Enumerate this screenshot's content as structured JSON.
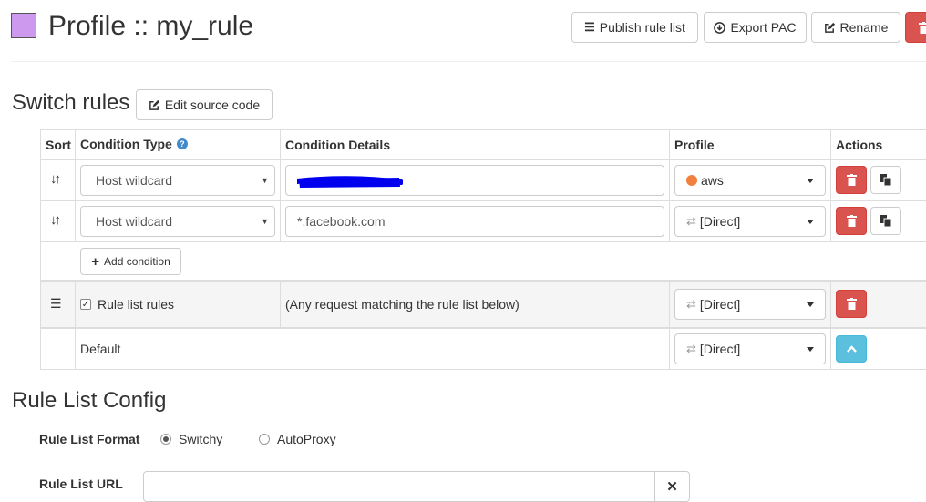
{
  "header": {
    "title": "Profile :: my_rule",
    "profile_color": "#cc99ee",
    "publish_label": "Publish rule list",
    "export_label": "Export PAC",
    "rename_label": "Rename"
  },
  "switch_rules": {
    "heading": "Switch rules",
    "edit_source_label": "Edit source code",
    "columns": {
      "sort": "Sort",
      "condition_type": "Condition Type",
      "condition_details": "Condition Details",
      "profile": "Profile",
      "actions": "Actions"
    },
    "rows": [
      {
        "condition_type": "Host wildcard",
        "condition_details": "",
        "profile": "aws",
        "profile_icon": "globe-icon",
        "profile_icon_color": "#f0803c"
      },
      {
        "condition_type": "Host wildcard",
        "condition_details": "*.facebook.com",
        "profile": "[Direct]",
        "profile_icon": "transfer-icon"
      }
    ],
    "add_condition_label": "Add condition",
    "rule_list_row": {
      "label": "Rule list rules",
      "checked": true,
      "details": "(Any request matching the rule list below)",
      "profile": "[Direct]"
    },
    "default_row": {
      "label": "Default",
      "profile": "[Direct]"
    }
  },
  "rule_list_config": {
    "heading": "Rule List Config",
    "format_label": "Rule List Format",
    "format_options": [
      "Switchy",
      "AutoProxy"
    ],
    "format_selected": "Switchy",
    "url_label": "Rule List URL"
  }
}
